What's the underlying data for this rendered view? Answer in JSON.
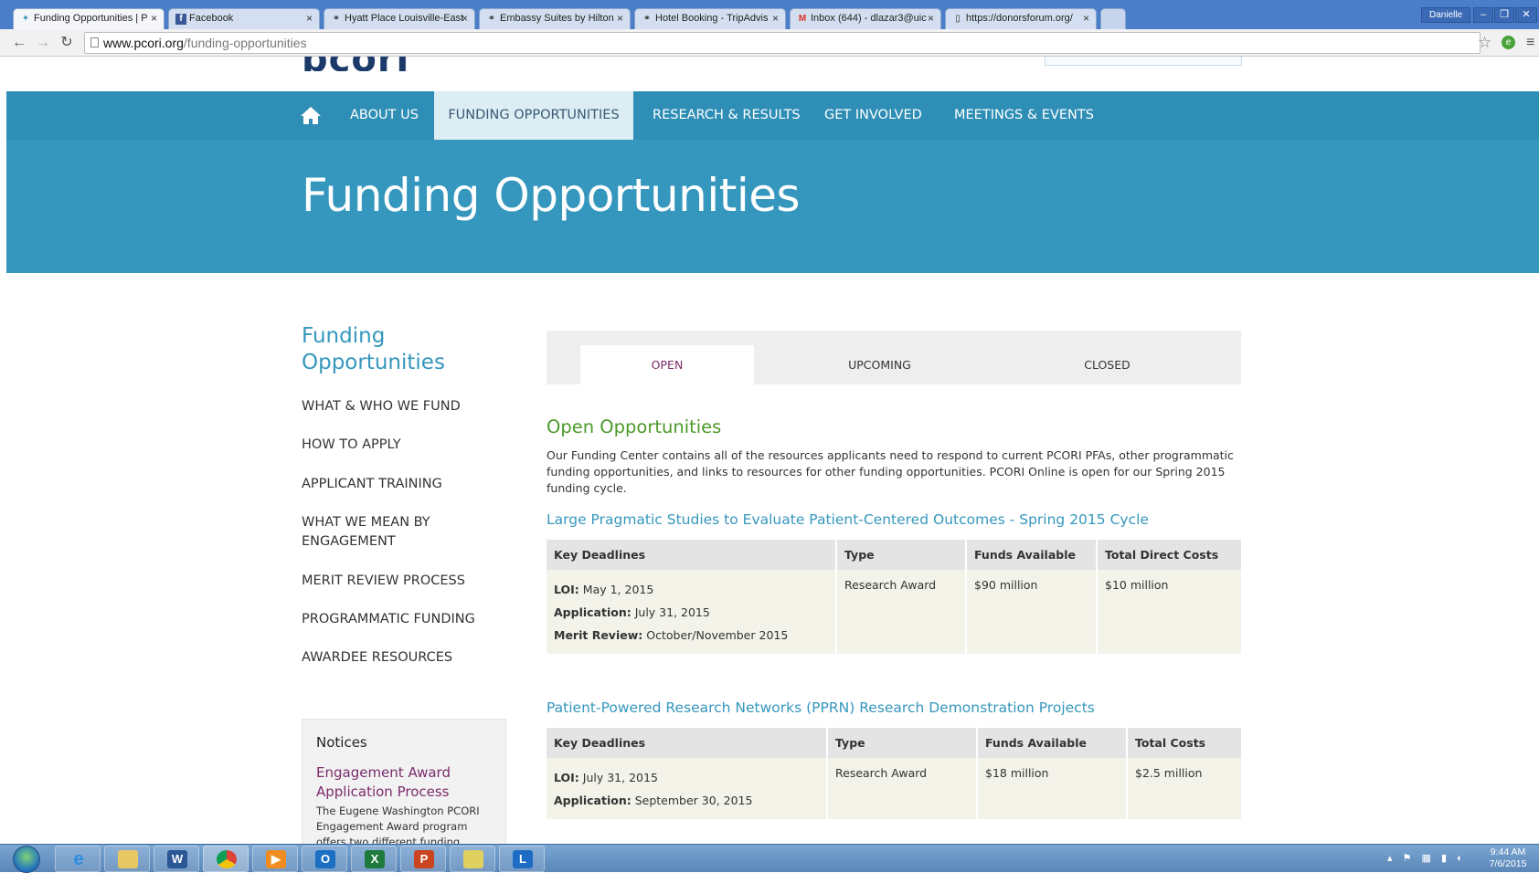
{
  "browser": {
    "tabs": [
      {
        "title": "Funding Opportunities | P",
        "favicon": "pcori-favicon",
        "active": true
      },
      {
        "title": "Facebook",
        "favicon": "facebook-icon"
      },
      {
        "title": "Hyatt Place Louisville-East",
        "favicon": "tripadvisor-icon"
      },
      {
        "title": "Embassy Suites by Hilton",
        "favicon": "tripadvisor-icon"
      },
      {
        "title": "Hotel Booking - TripAdvis",
        "favicon": "tripadvisor-icon"
      },
      {
        "title": "Inbox (644) - dlazar3@uic",
        "favicon": "gmail-icon"
      },
      {
        "title": "https://donorsforum.org/",
        "favicon": "page-icon"
      }
    ],
    "user": "Danielle",
    "url_host": "www.pcori.org",
    "url_path": "/funding-opportunities"
  },
  "site": {
    "logo": "pcori",
    "nav": [
      {
        "label": "ABOUT US"
      },
      {
        "label": "FUNDING OPPORTUNITIES",
        "active": true
      },
      {
        "label": "RESEARCH & RESULTS"
      },
      {
        "label": "GET INVOLVED"
      },
      {
        "label": "MEETINGS & EVENTS"
      }
    ],
    "hero_title": "Funding Opportunities"
  },
  "sidebar": {
    "title": "Funding Opportunities",
    "links": [
      "WHAT & WHO WE FUND",
      "HOW TO APPLY",
      "APPLICANT TRAINING",
      "WHAT WE MEAN BY ENGAGEMENT",
      "MERIT REVIEW PROCESS",
      "PROGRAMMATIC FUNDING",
      "AWARDEE RESOURCES"
    ],
    "notices": {
      "heading": "Notices",
      "title": "Engagement Award Application Process",
      "text": "The Eugene Washington PCORI Engagement Award program offers two different funding opportunities"
    }
  },
  "main": {
    "tabs": [
      "OPEN",
      "UPCOMING",
      "CLOSED"
    ],
    "heading": "Open Opportunities",
    "description": "Our Funding Center contains all of the resources applicants need to respond to current PCORI PFAs, other programmatic funding opportunities, and links to resources for other funding opportunities. PCORI Online is open for our Spring 2015 funding cycle.",
    "opportunities": [
      {
        "title": "Large Pragmatic Studies to Evaluate Patient-Centered Outcomes - Spring 2015 Cycle",
        "headers": [
          "Key Deadlines",
          "Type",
          "Funds Available",
          "Total Direct Costs"
        ],
        "deadlines": [
          {
            "label": "LOI:",
            "value": "May 1, 2015"
          },
          {
            "label": "Application:",
            "value": "July 31, 2015"
          },
          {
            "label": "Merit Review:",
            "value": "October/November 2015"
          }
        ],
        "type": "Research Award",
        "funds": "$90 million",
        "costs": "$10 million"
      },
      {
        "title": "Patient-Powered Research Networks (PPRN) Research Demonstration Projects",
        "headers": [
          "Key Deadlines",
          "Type",
          "Funds Available",
          "Total Costs"
        ],
        "deadlines": [
          {
            "label": "LOI:",
            "value": "July 31, 2015"
          },
          {
            "label": "Application:",
            "value": "September 30, 2015"
          }
        ],
        "type": "Research Award",
        "funds": "$18 million",
        "costs": "$2.5 million"
      }
    ]
  },
  "taskbar": {
    "apps": [
      "internet-explorer-icon",
      "file-explorer-icon",
      "word-icon",
      "chrome-icon",
      "media-player-icon",
      "outlook-icon",
      "excel-icon",
      "powerpoint-icon",
      "notes-icon",
      "lync-icon"
    ],
    "time": "9:44 AM",
    "date": "7/6/2015"
  },
  "colors": {
    "brand_blue": "#3597bd",
    "nav_blue": "#2e8eb5",
    "green_heading": "#4c9a2a",
    "purple": "#7a2c6b"
  }
}
